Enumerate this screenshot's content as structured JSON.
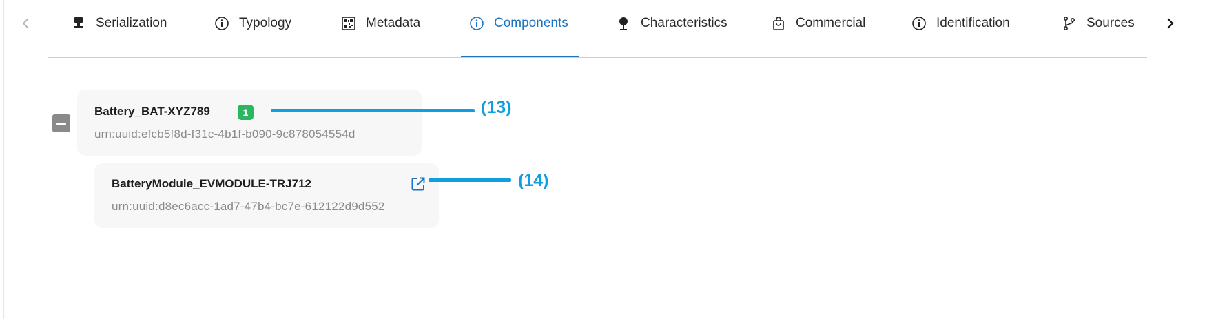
{
  "tabs": [
    {
      "label": "Serialization",
      "icon": "stamp-icon"
    },
    {
      "label": "Typology",
      "icon": "info-circle-icon"
    },
    {
      "label": "Metadata",
      "icon": "qr-code-icon"
    },
    {
      "label": "Components",
      "icon": "info-circle-icon",
      "active": true
    },
    {
      "label": "Characteristics",
      "icon": "pin-icon"
    },
    {
      "label": "Commercial",
      "icon": "shopping-bag-icon"
    },
    {
      "label": "Identification",
      "icon": "info-circle-icon"
    },
    {
      "label": "Sources",
      "icon": "branch-icon"
    }
  ],
  "tree": {
    "root": {
      "title": "Battery_BAT-XYZ789",
      "urn": "urn:uuid:efcb5f8d-f31c-4b1f-b090-9c878054554d",
      "badge": "1"
    },
    "child": {
      "title": "BatteryModule_EVMODULE-TRJ712",
      "urn": "urn:uuid:d8ec6acc-1ad7-47b4-bc7e-612122d9d552"
    }
  },
  "annotations": {
    "a13": "(13)",
    "a14": "(14)"
  },
  "colors": {
    "accent": "#1d74c2",
    "badge": "#2bb65f",
    "annotation": "#0f9fe0"
  }
}
